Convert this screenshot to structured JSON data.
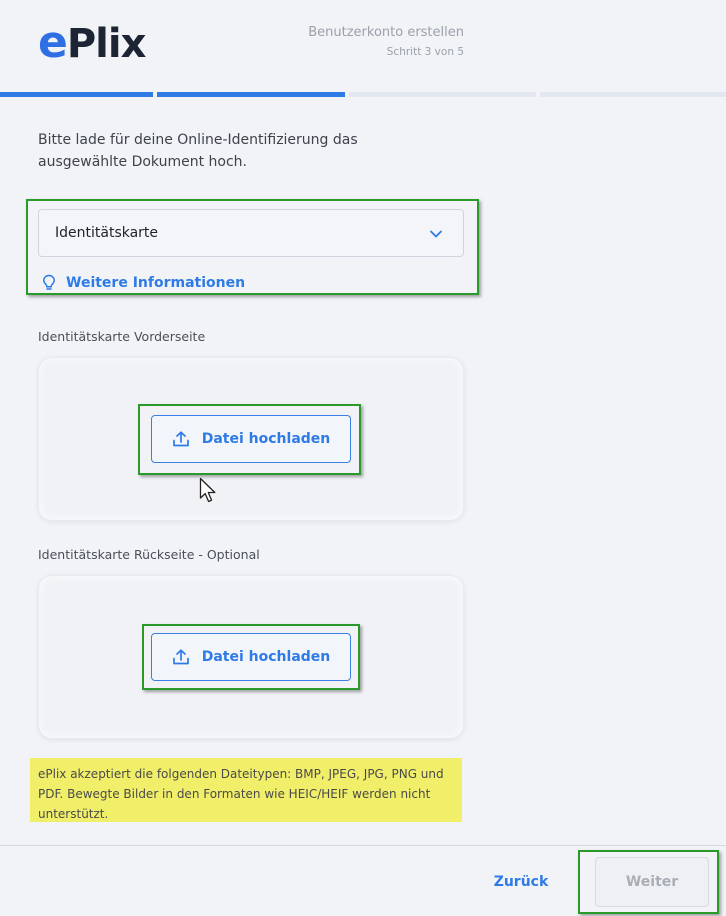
{
  "header": {
    "logo_e": "e",
    "logo_rest": "Plix",
    "title": "Benutzerkonto erstellen",
    "step": "Schritt 3 von 5",
    "progress": {
      "current_step": 3,
      "total_steps": 5
    }
  },
  "intro_text": "Bitte lade für deine Online-Identifizierung das ausgewählte Dokument hoch.",
  "document_select": {
    "value": "Identitätskarte",
    "icon": "chevron-down-icon"
  },
  "more_info": {
    "label": "Weitere Informationen",
    "icon": "lightbulb-icon"
  },
  "uploads": [
    {
      "label": "Identitätskarte Vorderseite",
      "button_label": "Datei hochladen",
      "icon": "upload-icon"
    },
    {
      "label": "Identitätskarte Rückseite - Optional",
      "button_label": "Datei hochladen",
      "icon": "upload-icon"
    }
  ],
  "notice": "ePlix akzeptiert die folgenden Dateitypen: BMP, JPEG, JPG, PNG und PDF. Bewegte Bilder in den Formaten wie HEIC/HEIF werden nicht unterstützt.",
  "footer": {
    "back_label": "Zurück",
    "next_label": "Weiter"
  },
  "colors": {
    "accent": "#2f7be6",
    "highlight_box": "#2a9a2a",
    "notice_bg": "#f1ef6a",
    "background": "#f1f3f7"
  }
}
